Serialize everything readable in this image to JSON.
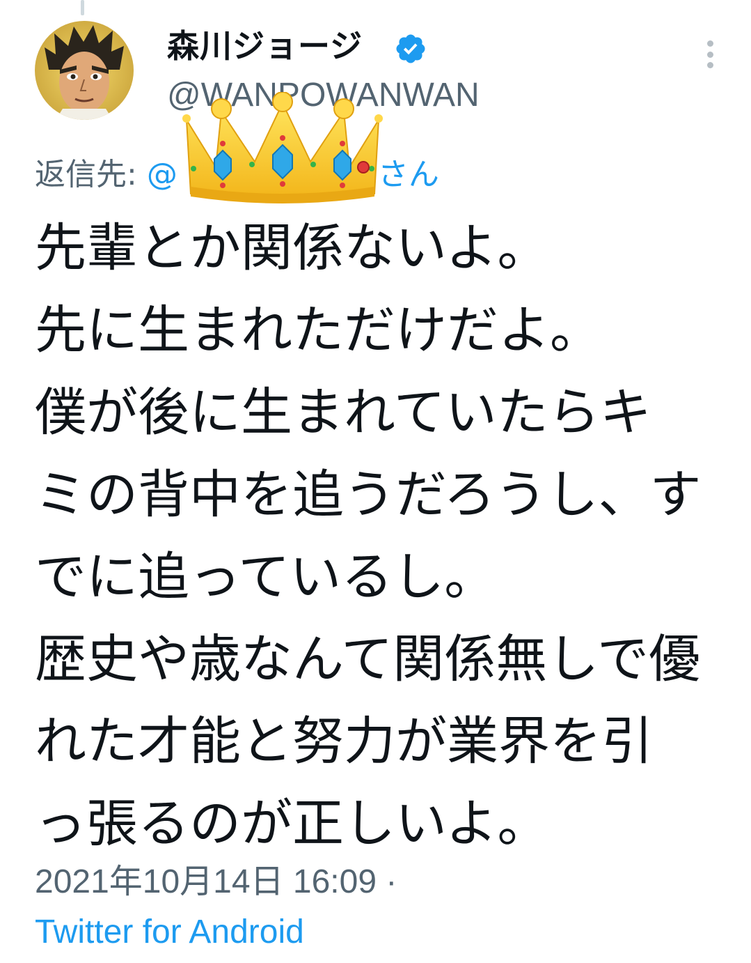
{
  "author": {
    "display_name": "森川ジョージ",
    "handle": "@WANPOWANWAN",
    "verified_icon": "verified-badge-icon",
    "avatar_icon": "avatar-anime-boxer"
  },
  "reply": {
    "label": "返信先:",
    "mention_start": "@",
    "mention_end": "0さん"
  },
  "overlay_icon": "crown-emoji",
  "tweet": {
    "lines": [
      "先輩とか関係ないよ。",
      "先に生まれただけだよ。",
      "僕が後に生まれていたらキ",
      "ミの背中を追うだろうし、す",
      "でに追っているし。",
      "歴史や歳なんて関係無しで優",
      "れた才能と努力が業界を引",
      "っ張るのが正しいよ。"
    ]
  },
  "meta": {
    "timestamp": "2021年10月14日 16:09 ·",
    "source": "Twitter for Android"
  },
  "colors": {
    "text": "#0f1419",
    "secondary": "#536471",
    "accent": "#1d9bf0"
  }
}
